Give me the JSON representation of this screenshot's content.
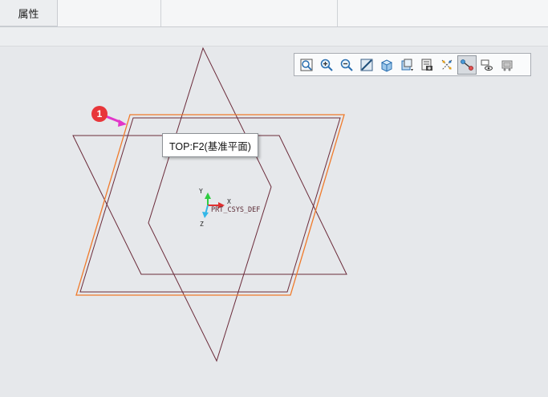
{
  "header": {
    "tabs": [
      {
        "label": "属性"
      }
    ]
  },
  "viewport": {
    "tooltip": "TOP:F2(基准平面)",
    "callout_number": "1",
    "csys_label": "PRT_CSYS_DEF",
    "axis_labels": {
      "x": "X",
      "y": "Y",
      "z": "Z"
    },
    "colors": {
      "datum_plane": "#6b2b3a",
      "highlight": "#f07a2a",
      "arrow": "#e236c9",
      "badge": "#e8363a"
    }
  },
  "toolbar": {
    "buttons": [
      {
        "name": "refit-icon"
      },
      {
        "name": "zoom-in-icon"
      },
      {
        "name": "zoom-out-icon"
      },
      {
        "name": "repaint-icon"
      },
      {
        "name": "display-style-icon"
      },
      {
        "name": "saved-orientations-icon"
      },
      {
        "name": "view-manager-icon"
      },
      {
        "name": "datum-display-filters-icon"
      },
      {
        "name": "annotation-display-icon",
        "active": true
      },
      {
        "name": "spin-center-icon"
      },
      {
        "name": "perspective-view-icon"
      }
    ]
  }
}
